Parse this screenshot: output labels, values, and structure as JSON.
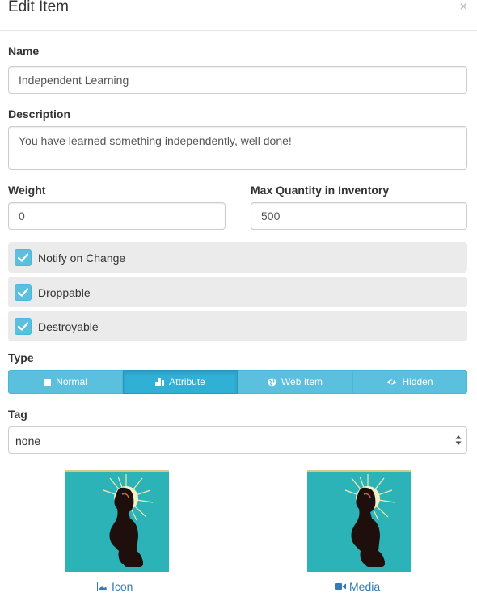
{
  "modal": {
    "title": "Edit Item",
    "close_glyph": "×"
  },
  "form": {
    "name_label": "Name",
    "name_value": "Independent Learning",
    "description_label": "Description",
    "description_value": "You have learned something independently, well done!",
    "weight_label": "Weight",
    "weight_value": "0",
    "max_quantity_label": "Max Quantity in Inventory",
    "max_quantity_value": "500",
    "checkboxes": [
      {
        "label": "Notify on Change",
        "checked": true
      },
      {
        "label": "Droppable",
        "checked": true
      },
      {
        "label": "Destroyable",
        "checked": true
      }
    ],
    "type_label": "Type",
    "type_options": [
      {
        "label": "Normal",
        "icon": "square-icon"
      },
      {
        "label": "Attribute",
        "icon": "bar-chart-icon"
      },
      {
        "label": "Web Item",
        "icon": "globe-icon"
      },
      {
        "label": "Hidden",
        "icon": "eye-slash-icon"
      }
    ],
    "type_selected": "Attribute",
    "tag_label": "Tag",
    "tag_value": "none"
  },
  "images": {
    "icon_link": "Icon",
    "media_link": "Media"
  },
  "colors": {
    "accent": "#5bc0de",
    "accent_active": "#31b0d5",
    "link": "#337ab7",
    "image_background": "#2bb3b8"
  }
}
